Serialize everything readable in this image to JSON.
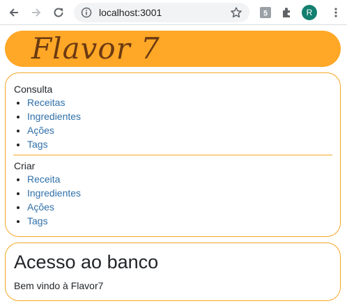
{
  "browser": {
    "url": "localhost:3001",
    "avatar_initial": "R"
  },
  "brand": {
    "title": "Flavor 7"
  },
  "menu": {
    "consulta": {
      "title": "Consulta",
      "links": [
        "Receitas",
        "Ingredientes",
        "Ações",
        "Tags"
      ]
    },
    "criar": {
      "title": "Criar",
      "links": [
        "Receita",
        "Ingredientes",
        "Ações",
        "Tags"
      ]
    }
  },
  "welcome": {
    "title": "Acesso ao banco",
    "text": "Bem vindo à Flavor7"
  },
  "colors": {
    "accent": "#ffa726",
    "border": "#f4a624",
    "link": "#2f6fa8",
    "brand_text": "#6b3a12",
    "avatar": "#137f6f"
  }
}
